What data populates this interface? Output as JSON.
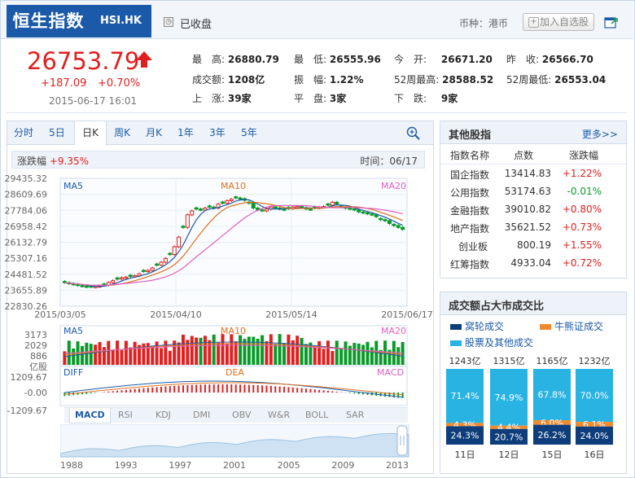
{
  "header": {
    "name": "恒生指数",
    "code": "HSI.HK",
    "market_status": "已收盘",
    "currency": "币种：港币",
    "add_watchlist": "加入自选股"
  },
  "quote": {
    "price": "26753.79",
    "change": "+187.09",
    "change_pct": "+0.70%",
    "time": "2015-06-17 16:01"
  },
  "stats": {
    "high_label": "最　高:",
    "high": "26880.79",
    "low_label": "最　低:",
    "low": "26555.96",
    "open_label": "今　开:",
    "open": "26671.20",
    "prevclose_label": "昨　收:",
    "prevclose": "26566.70",
    "turnover_label": "成交额:",
    "turnover": "1208亿",
    "amplitude_label": "振　幅:",
    "amplitude": "1.22%",
    "high52_label": "52周最高:",
    "high52": "28588.52",
    "low52_label": "52周最低:",
    "low52": "26553.04",
    "up_label": "上　涨:",
    "up": "39家",
    "flat_label": "平　盘:",
    "flat": "3家",
    "down_label": "下　跌:",
    "down": "9家"
  },
  "tabs": [
    "分时",
    "5日",
    "日K",
    "周K",
    "月K",
    "1年",
    "3年",
    "5年"
  ],
  "infobar": {
    "label": "涨跌幅",
    "value": "+9.35%",
    "time_label": "时间：",
    "time": "06/17"
  },
  "chart_data": [
    {
      "type": "line",
      "title": "",
      "yticks": [
        "29435.32",
        "28609.69",
        "27784.06",
        "26958.42",
        "26132.79",
        "25307.16",
        "24481.52",
        "23655.89",
        "22830.26"
      ],
      "ylim": [
        22830.26,
        29435.32
      ],
      "xticks": [
        "2015/03/05",
        "2015/04/10",
        "2015/05/14",
        "2015/06/17"
      ],
      "series": [
        {
          "name": "MA5",
          "color": "#1b5aa8"
        },
        {
          "name": "MA10",
          "color": "#e0701f"
        },
        {
          "name": "MA20",
          "color": "#e060c0"
        }
      ],
      "candles_close": [
        24050,
        24000,
        23950,
        23900,
        23870,
        23830,
        23820,
        23850,
        23880,
        23920,
        24050,
        24150,
        24230,
        24300,
        24330,
        24370,
        24400,
        24500,
        24620,
        24680,
        24800,
        24950,
        25100,
        25300,
        25500,
        25900,
        26400,
        26900,
        27550,
        27750,
        27850,
        27800,
        27900,
        27950,
        27900,
        28100,
        28150,
        28280,
        28350,
        28420,
        28380,
        28300,
        28150,
        27900,
        27800,
        27750,
        27850,
        27950,
        27900,
        27850,
        27800,
        27870,
        27950,
        27980,
        27920,
        27850,
        27820,
        27900,
        27950,
        27980,
        28050,
        28200,
        28100,
        27950,
        27900,
        27850,
        27800,
        27700,
        27650,
        27600,
        27550,
        27450,
        27300,
        27250,
        27100,
        27000,
        26900,
        26800
      ]
    },
    {
      "type": "bar",
      "title": "",
      "yticks": [
        "3173",
        "2029",
        "886",
        "亿股"
      ],
      "series": [
        {
          "name": "MA5"
        },
        {
          "name": "MA10"
        },
        {
          "name": "MA20"
        }
      ]
    },
    {
      "type": "line",
      "title": "",
      "yticks": [
        "1209.67",
        "-0.00",
        "-1209.67"
      ],
      "series": [
        {
          "name": "DIFF"
        },
        {
          "name": "DEA"
        },
        {
          "name": "MACD"
        }
      ]
    }
  ],
  "indicator_tabs": [
    "MACD",
    "RSI",
    "KDJ",
    "DMI",
    "OBV",
    "W&R",
    "BOLL",
    "SAR"
  ],
  "timeline_years": [
    "1988",
    "1993",
    "1997",
    "2001",
    "2005",
    "2009",
    "2013"
  ],
  "other_indices": {
    "title": "其他股指",
    "more": "更多>>",
    "headers": [
      "指数名称",
      "点数",
      "涨跌幅"
    ],
    "rows": [
      {
        "name": "国企指数",
        "value": "13414.83",
        "pct": "+1.22%",
        "color": "#e02020"
      },
      {
        "name": "公用指数",
        "value": "53174.63",
        "pct": "-0.01%",
        "color": "#0a9a2a"
      },
      {
        "name": "金融指数",
        "value": "39010.82",
        "pct": "+0.80%",
        "color": "#e02020"
      },
      {
        "name": "地产指数",
        "value": "35621.52",
        "pct": "+0.73%",
        "color": "#e02020"
      },
      {
        "name": "创业板",
        "value": "800.19",
        "pct": "+1.55%",
        "color": "#e02020"
      },
      {
        "name": "红筹指数",
        "value": "4933.04",
        "pct": "+0.72%",
        "color": "#e02020"
      }
    ]
  },
  "turnover_panel": {
    "title": "成交额占大市成交比",
    "legend": [
      {
        "label": "窝轮成交",
        "color": "#0d3d7a"
      },
      {
        "label": "牛熊证成交",
        "color": "#f08a2e"
      },
      {
        "label": "股票及其他成交",
        "color": "#29b3e3"
      }
    ],
    "chart_data": {
      "type": "bar",
      "categories": [
        "11日",
        "12日",
        "15日",
        "16日"
      ],
      "totals": [
        "1243亿",
        "1315亿",
        "1165亿",
        "1232亿"
      ],
      "series": [
        {
          "name": "股票及其他成交",
          "values": [
            71.4,
            74.9,
            67.8,
            70.0
          ],
          "labels": [
            "71.4%",
            "74.9%",
            "67.8%",
            "70.0%"
          ]
        },
        {
          "name": "牛熊证成交",
          "values": [
            4.3,
            4.4,
            6.0,
            6.1
          ],
          "labels": [
            "4.3%",
            "4.4%",
            "6.0%",
            "6.1%"
          ]
        },
        {
          "name": "窝轮成交",
          "values": [
            24.3,
            20.7,
            26.2,
            24.0
          ],
          "labels": [
            "24.3%",
            "20.7%",
            "26.2%",
            "24.0%"
          ]
        }
      ]
    }
  }
}
